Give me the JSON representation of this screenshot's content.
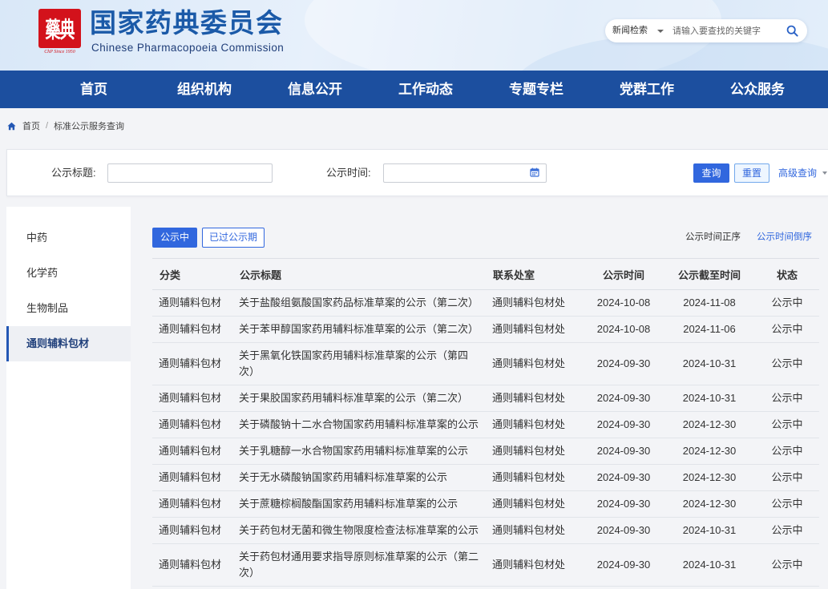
{
  "colors": {
    "brand_blue": "#1b5aa8",
    "nav_bg": "#1c4f9f",
    "accent_blue": "#3167de",
    "logo_red": "#d3121b",
    "page_bg": "#f3f4f7",
    "text": "#333333"
  },
  "header": {
    "logo": {
      "seal": "藥典",
      "caption": "ChP Since 1950"
    },
    "title": "国家药典委员会",
    "subtitle": "Chinese Pharmacopoeia Commission",
    "search": {
      "scope": "新闻检索",
      "placeholder": "请输入要查找的关键字",
      "icon": "search-icon"
    }
  },
  "nav": [
    "首页",
    "组织机构",
    "信息公开",
    "工作动态",
    "专题专栏",
    "党群工作",
    "公众服务"
  ],
  "breadcrumb": {
    "icon": "home-icon",
    "home": "首页",
    "separator": "/",
    "current": "标准公示服务查询"
  },
  "filters": {
    "title_label": "公示标题:",
    "title_value": "",
    "time_label": "公示时间:",
    "time_value": "",
    "time_icon": "calendar-icon",
    "search_button": "查询",
    "reset_button": "重置",
    "advanced_link": "高级查询"
  },
  "sidebar": {
    "items": [
      "中药",
      "化学药",
      "生物制品",
      "通则辅料包材"
    ],
    "active": "通则辅料包材"
  },
  "tabs": {
    "items": [
      "公示中",
      "已过公示期"
    ],
    "active": "公示中"
  },
  "sort": {
    "items": [
      "公示时间正序",
      "公示时间倒序"
    ],
    "highlighted": "公示时间倒序"
  },
  "table": {
    "columns": [
      "分类",
      "公示标题",
      "联系处室",
      "公示时间",
      "公示截至时间",
      "状态"
    ],
    "rows": [
      {
        "category": "通则辅料包材",
        "title": "关于盐酸组氨酸国家药品标准草案的公示（第二次）",
        "department": "通则辅料包材处",
        "publish_date": "2024-10-08",
        "deadline": "2024-11-08",
        "status": "公示中"
      },
      {
        "category": "通则辅料包材",
        "title": "关于苯甲醇国家药用辅料标准草案的公示（第二次）",
        "department": "通则辅料包材处",
        "publish_date": "2024-10-08",
        "deadline": "2024-11-06",
        "status": "公示中"
      },
      {
        "category": "通则辅料包材",
        "title": "关于黑氧化铁国家药用辅料标准草案的公示（第四次）",
        "department": "通则辅料包材处",
        "publish_date": "2024-09-30",
        "deadline": "2024-10-31",
        "status": "公示中"
      },
      {
        "category": "通则辅料包材",
        "title": "关于果胶国家药用辅料标准草案的公示（第二次）",
        "department": "通则辅料包材处",
        "publish_date": "2024-09-30",
        "deadline": "2024-10-31",
        "status": "公示中"
      },
      {
        "category": "通则辅料包材",
        "title": "关于磷酸钠十二水合物国家药用辅料标准草案的公示",
        "department": "通则辅料包材处",
        "publish_date": "2024-09-30",
        "deadline": "2024-12-30",
        "status": "公示中"
      },
      {
        "category": "通则辅料包材",
        "title": "关于乳糖醇一水合物国家药用辅料标准草案的公示",
        "department": "通则辅料包材处",
        "publish_date": "2024-09-30",
        "deadline": "2024-12-30",
        "status": "公示中"
      },
      {
        "category": "通则辅料包材",
        "title": "关于无水磷酸钠国家药用辅料标准草案的公示",
        "department": "通则辅料包材处",
        "publish_date": "2024-09-30",
        "deadline": "2024-12-30",
        "status": "公示中"
      },
      {
        "category": "通则辅料包材",
        "title": "关于蔗糖棕榈酸酯国家药用辅料标准草案的公示",
        "department": "通则辅料包材处",
        "publish_date": "2024-09-30",
        "deadline": "2024-12-30",
        "status": "公示中"
      },
      {
        "category": "通则辅料包材",
        "title": "关于药包材无菌和微生物限度检查法标准草案的公示",
        "department": "通则辅料包材处",
        "publish_date": "2024-09-30",
        "deadline": "2024-10-31",
        "status": "公示中"
      },
      {
        "category": "通则辅料包材",
        "title": "关于药包材通用要求指导原则标准草案的公示（第二次）",
        "department": "通则辅料包材处",
        "publish_date": "2024-09-30",
        "deadline": "2024-10-31",
        "status": "公示中"
      }
    ]
  }
}
